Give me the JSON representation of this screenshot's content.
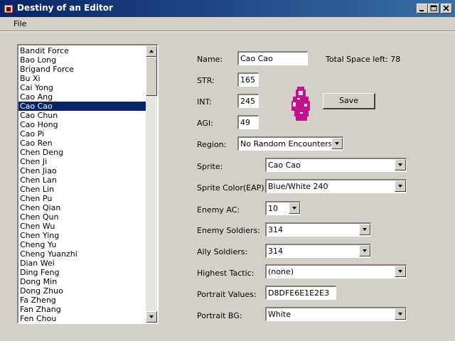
{
  "window": {
    "title": "Destiny of an Editor",
    "controls": [
      "minimize",
      "maximize",
      "close"
    ]
  },
  "menu": {
    "file": "File"
  },
  "list": {
    "items": [
      "Bandit Force",
      "Bao Long",
      "Brigand Force",
      "Bu Xi",
      "Cai Yong",
      "Cao Ang",
      "Cao Cao",
      "Cao Chun",
      "Cao Hong",
      "Cao Pi",
      "Cao Ren",
      "Chen Deng",
      "Chen Ji",
      "Chen Jiao",
      "Chen Lan",
      "Chen Lin",
      "Chen Pu",
      "Chen Qian",
      "Chen Qun",
      "Chen Wu",
      "Chen Ying",
      "Cheng Yu",
      "Cheng Yuanzhi",
      "Dian Wei",
      "Ding Feng",
      "Dong Min",
      "Dong Zhuo",
      "Fa Zheng",
      "Fan Zhang",
      "Fen Chou"
    ],
    "selected": "Cao Cao",
    "selected_color": "#0a246a"
  },
  "form": {
    "name_label": "Name:",
    "name_value": "Cao Cao",
    "space_label": "Total Space left: 78",
    "str_label": "STR:",
    "str_value": "165",
    "int_label": "INT:",
    "int_value": "245",
    "agi_label": "AGI:",
    "agi_value": "49",
    "save_label": "Save",
    "region_label": "Region:",
    "region_value": "No Random Encounters",
    "sprite_label": "Sprite:",
    "sprite_value": "Cao Cao",
    "sprite_color_label": "Sprite Color(EAP):",
    "sprite_color_value": "Blue/White 240",
    "enemy_ac_label": "Enemy AC:",
    "enemy_ac_value": "10",
    "enemy_soldiers_label": "Enemy Soldiers:",
    "enemy_soldiers_value": "314",
    "ally_soldiers_label": "Ally Soldiers:",
    "ally_soldiers_value": "314",
    "highest_tactic_label": "Highest Tactic:",
    "highest_tactic_value": "(none)",
    "portrait_values_label": "Portrait Values:",
    "portrait_values_value": "D8DFE6E1E2E3",
    "portrait_bg_label": "Portrait BG:",
    "portrait_bg_value": "White"
  },
  "colors": {
    "titlebar": "#0a246a",
    "sprite": "#c0148c"
  }
}
